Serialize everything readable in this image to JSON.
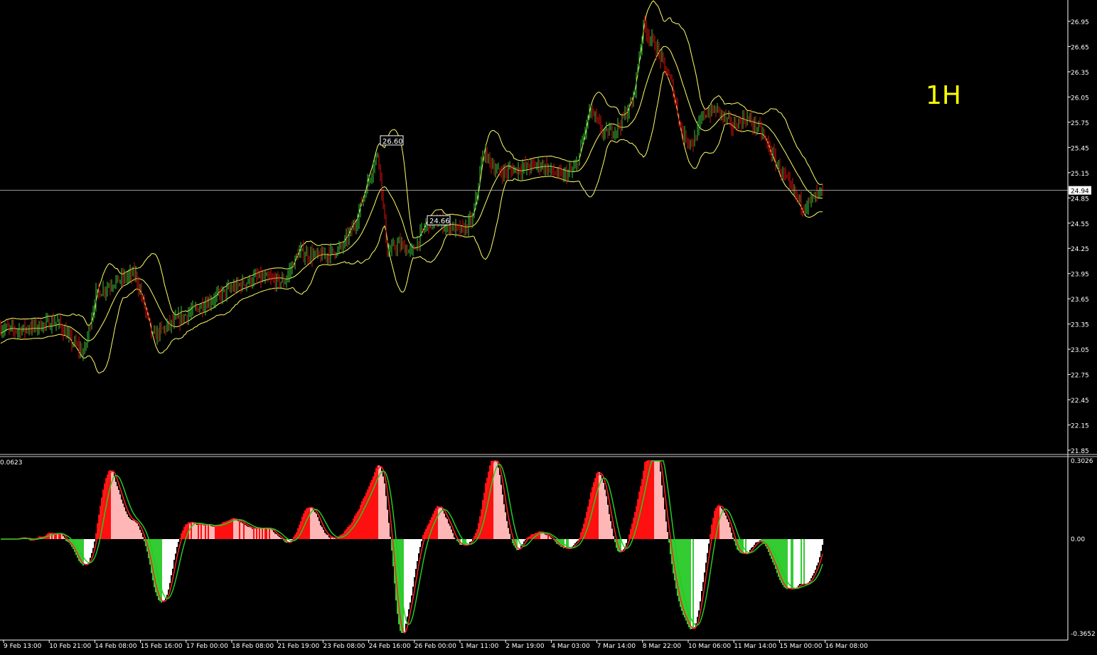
{
  "timeframe_label": "1H",
  "price_axis": {
    "ticks": [
      "26.95",
      "26.65",
      "26.35",
      "26.05",
      "25.75",
      "25.45",
      "25.15",
      "24.85",
      "24.55",
      "24.25",
      "23.95",
      "23.65",
      "23.35",
      "23.05",
      "22.75",
      "22.45",
      "22.15",
      "21.85"
    ],
    "min": 21.85,
    "max": 26.95,
    "current_price": "24.94",
    "current_price_value": 24.94
  },
  "price_markers": [
    {
      "label": "26.60",
      "value": 25.53
    },
    {
      "label": "24.66",
      "value": 24.58
    }
  ],
  "oscillator": {
    "top_label": "0.3026",
    "zero_label": "0.00",
    "bottom_label": "-0.3652",
    "left_label": "0.0623",
    "max": 0.3026,
    "min": -0.3652
  },
  "time_axis": [
    "9 Feb 13:00",
    "10 Feb 21:00",
    "14 Feb 08:00",
    "15 Feb 16:00",
    "17 Feb 00:00",
    "18 Feb 08:00",
    "21 Feb 19:00",
    "23 Feb 08:00",
    "24 Feb 16:00",
    "26 Feb 00:00",
    "1 Mar 11:00",
    "2 Mar 19:00",
    "4 Mar 03:00",
    "7 Mar 14:00",
    "8 Mar 22:00",
    "10 Mar 06:00",
    "11 Mar 14:00",
    "15 Mar 00:00",
    "16 Mar 08:00"
  ],
  "colors": {
    "background": "#000000",
    "candle_up": "#3cc43c",
    "candle_down": "#e01010",
    "band": "#ffff66",
    "axis_text": "#ffffff",
    "grid_separator": "#c8c8c8",
    "timeframe": "#ffff00",
    "macd_fast": "#ff2020",
    "macd_slow": "#22cc22"
  },
  "chart_data": {
    "type": "line",
    "series": [],
    "close_keypoints": [
      [
        0,
        23.3
      ],
      [
        25,
        23.28
      ],
      [
        55,
        23.33
      ],
      [
        80,
        23.38
      ],
      [
        100,
        23.15
      ],
      [
        118,
        23.0
      ],
      [
        135,
        23.7
      ],
      [
        160,
        23.85
      ],
      [
        190,
        23.95
      ],
      [
        205,
        23.5
      ],
      [
        215,
        23.2
      ],
      [
        240,
        23.35
      ],
      [
        280,
        23.55
      ],
      [
        320,
        23.75
      ],
      [
        360,
        23.9
      ],
      [
        400,
        23.85
      ],
      [
        420,
        24.2
      ],
      [
        450,
        24.15
      ],
      [
        480,
        24.25
      ],
      [
        500,
        24.55
      ],
      [
        520,
        25.1
      ],
      [
        532,
        25.4
      ],
      [
        545,
        24.2
      ],
      [
        560,
        24.3
      ],
      [
        580,
        24.2
      ],
      [
        600,
        24.55
      ],
      [
        620,
        24.55
      ],
      [
        650,
        24.45
      ],
      [
        665,
        24.6
      ],
      [
        680,
        25.4
      ],
      [
        700,
        25.15
      ],
      [
        730,
        25.2
      ],
      [
        760,
        25.25
      ],
      [
        790,
        25.1
      ],
      [
        810,
        25.2
      ],
      [
        830,
        25.9
      ],
      [
        850,
        25.6
      ],
      [
        870,
        25.7
      ],
      [
        890,
        26.0
      ],
      [
        905,
        26.9
      ],
      [
        925,
        26.6
      ],
      [
        945,
        26.2
      ],
      [
        960,
        25.6
      ],
      [
        975,
        25.5
      ],
      [
        990,
        25.85
      ],
      [
        1010,
        25.9
      ],
      [
        1030,
        25.7
      ],
      [
        1050,
        25.8
      ],
      [
        1070,
        25.65
      ],
      [
        1090,
        25.3
      ],
      [
        1110,
        25.0
      ],
      [
        1130,
        24.75
      ],
      [
        1145,
        24.85
      ],
      [
        1158,
        24.94
      ]
    ]
  }
}
